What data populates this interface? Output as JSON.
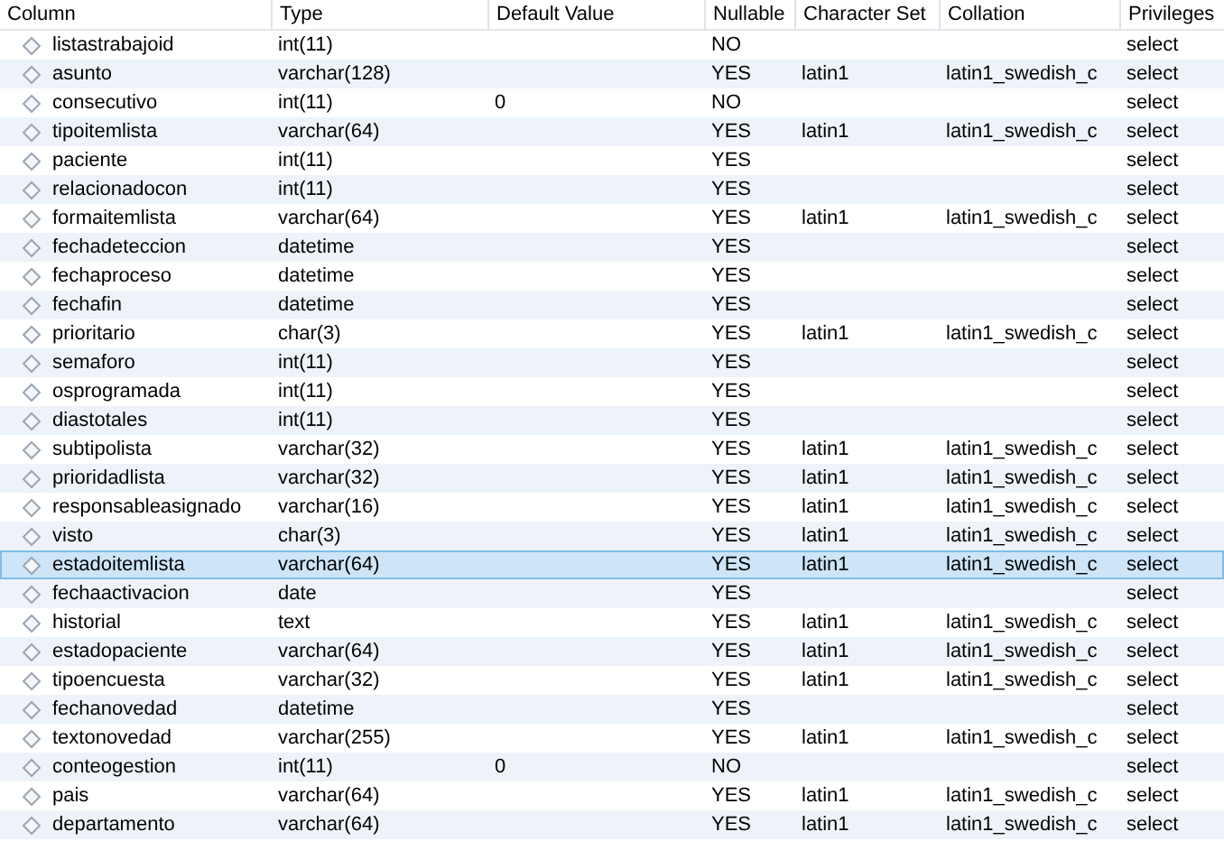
{
  "table": {
    "columns": [
      "Column",
      "Type",
      "Default Value",
      "Nullable",
      "Character Set",
      "Collation",
      "Privileges"
    ],
    "rows": [
      {
        "column": "listastrabajoid",
        "type": "int(11)",
        "nullable": "NO",
        "privileges": "select",
        "selected": false
      },
      {
        "column": "asunto",
        "type": "varchar(128)",
        "nullable": "YES",
        "character_set": "latin1",
        "collation": "latin1_swedish_c",
        "privileges": "select",
        "selected": false
      },
      {
        "column": "consecutivo",
        "type": "int(11)",
        "default": "0",
        "nullable": "NO",
        "privileges": "select",
        "selected": false
      },
      {
        "column": "tipoitemlista",
        "type": "varchar(64)",
        "nullable": "YES",
        "character_set": "latin1",
        "collation": "latin1_swedish_c",
        "privileges": "select",
        "selected": false
      },
      {
        "column": "paciente",
        "type": "int(11)",
        "nullable": "YES",
        "privileges": "select",
        "selected": false
      },
      {
        "column": "relacionadocon",
        "type": "int(11)",
        "nullable": "YES",
        "privileges": "select",
        "selected": false
      },
      {
        "column": "formaitemlista",
        "type": "varchar(64)",
        "nullable": "YES",
        "character_set": "latin1",
        "collation": "latin1_swedish_c",
        "privileges": "select",
        "selected": false
      },
      {
        "column": "fechadeteccion",
        "type": "datetime",
        "nullable": "YES",
        "privileges": "select",
        "selected": false
      },
      {
        "column": "fechaproceso",
        "type": "datetime",
        "nullable": "YES",
        "privileges": "select",
        "selected": false
      },
      {
        "column": "fechafin",
        "type": "datetime",
        "nullable": "YES",
        "privileges": "select",
        "selected": false
      },
      {
        "column": "prioritario",
        "type": "char(3)",
        "nullable": "YES",
        "character_set": "latin1",
        "collation": "latin1_swedish_c",
        "privileges": "select",
        "selected": false
      },
      {
        "column": "semaforo",
        "type": "int(11)",
        "nullable": "YES",
        "privileges": "select",
        "selected": false
      },
      {
        "column": "osprogramada",
        "type": "int(11)",
        "nullable": "YES",
        "privileges": "select",
        "selected": false
      },
      {
        "column": "diastotales",
        "type": "int(11)",
        "nullable": "YES",
        "privileges": "select",
        "selected": false
      },
      {
        "column": "subtipolista",
        "type": "varchar(32)",
        "nullable": "YES",
        "character_set": "latin1",
        "collation": "latin1_swedish_c",
        "privileges": "select",
        "selected": false
      },
      {
        "column": "prioridadlista",
        "type": "varchar(32)",
        "nullable": "YES",
        "character_set": "latin1",
        "collation": "latin1_swedish_c",
        "privileges": "select",
        "selected": false
      },
      {
        "column": "responsableasignado",
        "type": "varchar(16)",
        "nullable": "YES",
        "character_set": "latin1",
        "collation": "latin1_swedish_c",
        "privileges": "select",
        "selected": false
      },
      {
        "column": "visto",
        "type": "char(3)",
        "nullable": "YES",
        "character_set": "latin1",
        "collation": "latin1_swedish_c",
        "privileges": "select",
        "selected": false
      },
      {
        "column": "estadoitemlista",
        "type": "varchar(64)",
        "nullable": "YES",
        "character_set": "latin1",
        "collation": "latin1_swedish_c",
        "privileges": "select",
        "selected": true
      },
      {
        "column": "fechaactivacion",
        "type": "date",
        "nullable": "YES",
        "privileges": "select",
        "selected": false
      },
      {
        "column": "historial",
        "type": "text",
        "nullable": "YES",
        "character_set": "latin1",
        "collation": "latin1_swedish_c",
        "privileges": "select",
        "selected": false
      },
      {
        "column": "estadopaciente",
        "type": "varchar(64)",
        "nullable": "YES",
        "character_set": "latin1",
        "collation": "latin1_swedish_c",
        "privileges": "select",
        "selected": false
      },
      {
        "column": "tipoencuesta",
        "type": "varchar(32)",
        "nullable": "YES",
        "character_set": "latin1",
        "collation": "latin1_swedish_c",
        "privileges": "select",
        "selected": false
      },
      {
        "column": "fechanovedad",
        "type": "datetime",
        "nullable": "YES",
        "privileges": "select",
        "selected": false
      },
      {
        "column": "textonovedad",
        "type": "varchar(255)",
        "nullable": "YES",
        "character_set": "latin1",
        "collation": "latin1_swedish_c",
        "privileges": "select",
        "selected": false
      },
      {
        "column": "conteogestion",
        "type": "int(11)",
        "default": "0",
        "nullable": "NO",
        "privileges": "select",
        "selected": false
      },
      {
        "column": "pais",
        "type": "varchar(64)",
        "nullable": "YES",
        "character_set": "latin1",
        "collation": "latin1_swedish_c",
        "privileges": "select",
        "selected": false
      },
      {
        "column": "departamento",
        "type": "varchar(64)",
        "nullable": "YES",
        "character_set": "latin1",
        "collation": "latin1_swedish_c",
        "privileges": "select",
        "selected": false
      }
    ]
  }
}
